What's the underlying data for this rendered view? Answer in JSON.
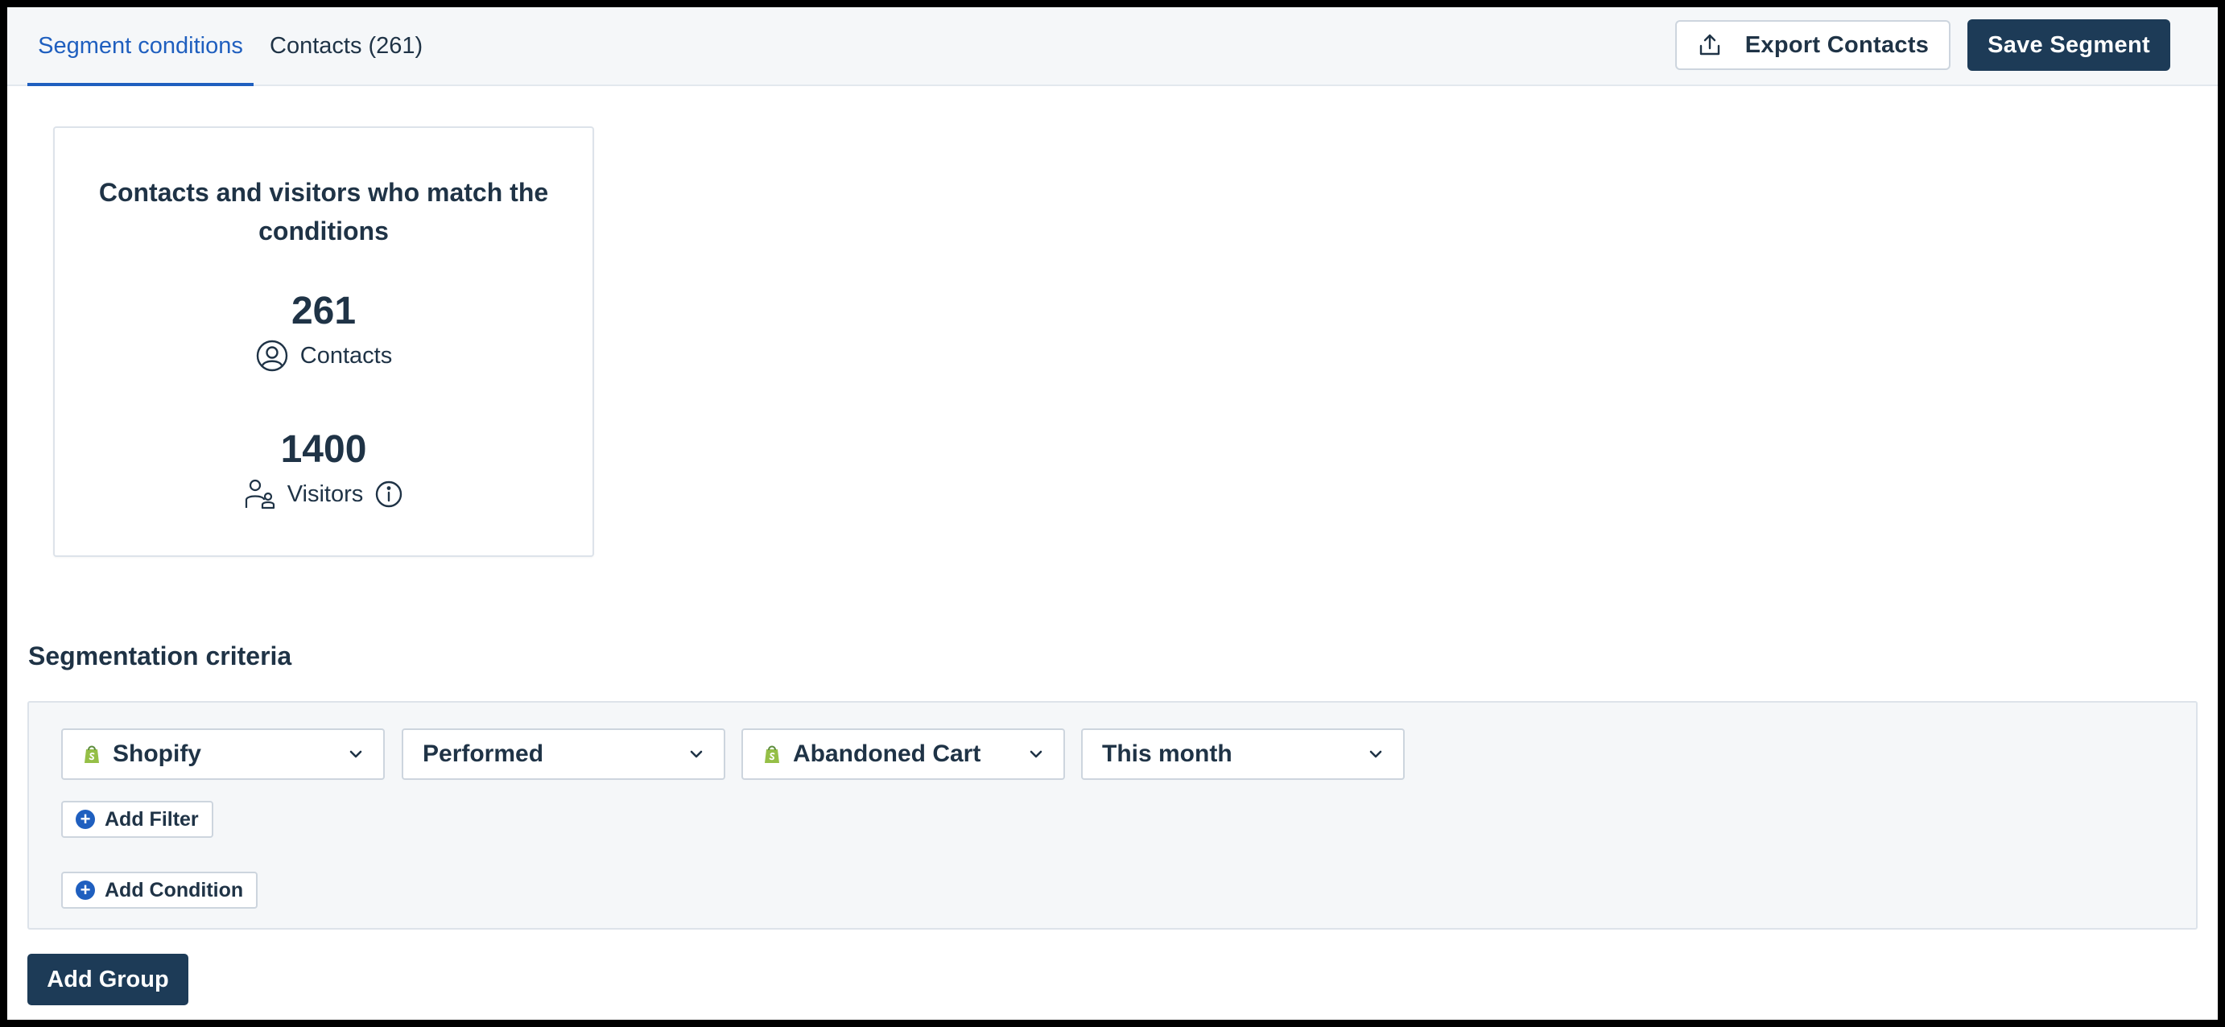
{
  "tabs": [
    {
      "label": "Segment conditions",
      "active": true
    },
    {
      "label": "Contacts (261)",
      "active": false
    }
  ],
  "header": {
    "export_label": "Export Contacts",
    "save_label": "Save Segment"
  },
  "summary": {
    "title": "Contacts and visitors who match the conditions",
    "contacts_count": "261",
    "contacts_label": "Contacts",
    "visitors_count": "1400",
    "visitors_label": "Visitors"
  },
  "criteria": {
    "title": "Segmentation criteria",
    "conditions": [
      {
        "source": "Shopify",
        "operator": "Performed",
        "event": "Abandoned Cart",
        "period": "This month"
      }
    ],
    "add_filter_label": "Add Filter",
    "add_condition_label": "Add Condition"
  },
  "add_group_label": "Add Group",
  "colors": {
    "accent": "#1f5fbf",
    "primary_button": "#1d3b57",
    "text": "#1f3346",
    "shopify_green": "#95bf47"
  }
}
